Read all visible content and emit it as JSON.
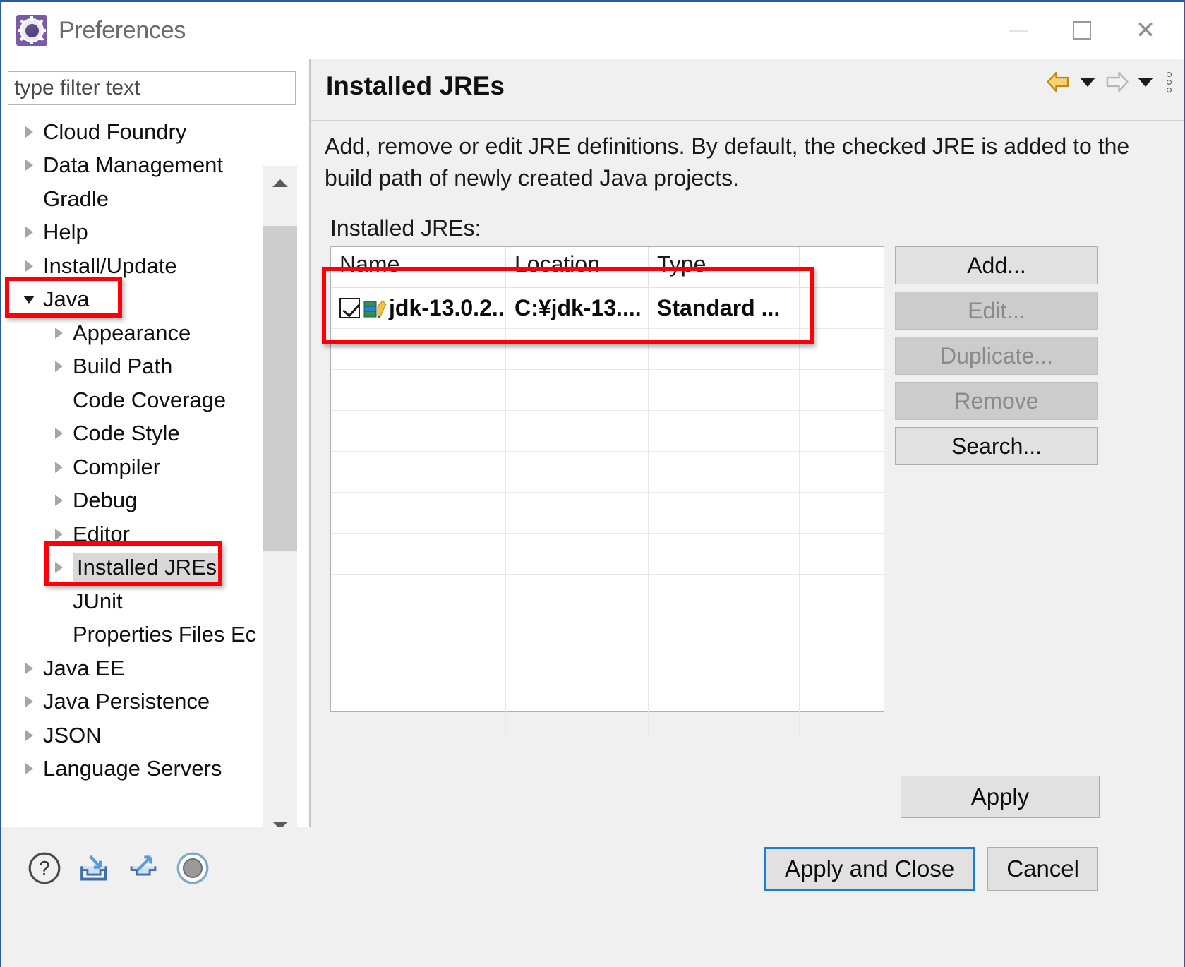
{
  "window": {
    "title": "Preferences",
    "icon": "preferences-gear-icon",
    "controls": {
      "minimize": "—",
      "maximize": "□",
      "close": "✕"
    }
  },
  "sidebar": {
    "filter": {
      "placeholder": "type filter text",
      "value": ""
    },
    "items": [
      {
        "label": "Cloud Foundry",
        "depth": 0,
        "twisty": "right",
        "selected": false
      },
      {
        "label": "Data Management",
        "depth": 0,
        "twisty": "right",
        "selected": false
      },
      {
        "label": "Gradle",
        "depth": 0,
        "twisty": "none",
        "selected": false
      },
      {
        "label": "Help",
        "depth": 0,
        "twisty": "right",
        "selected": false
      },
      {
        "label": "Install/Update",
        "depth": 0,
        "twisty": "right",
        "selected": false
      },
      {
        "label": "Java",
        "depth": 0,
        "twisty": "down",
        "selected": false
      },
      {
        "label": "Appearance",
        "depth": 1,
        "twisty": "right",
        "selected": false
      },
      {
        "label": "Build Path",
        "depth": 1,
        "twisty": "right",
        "selected": false
      },
      {
        "label": "Code Coverage",
        "depth": 1,
        "twisty": "none",
        "selected": false
      },
      {
        "label": "Code Style",
        "depth": 1,
        "twisty": "right",
        "selected": false
      },
      {
        "label": "Compiler",
        "depth": 1,
        "twisty": "right",
        "selected": false
      },
      {
        "label": "Debug",
        "depth": 1,
        "twisty": "right",
        "selected": false
      },
      {
        "label": "Editor",
        "depth": 1,
        "twisty": "right",
        "selected": false
      },
      {
        "label": "Installed JREs",
        "depth": 1,
        "twisty": "right",
        "selected": true
      },
      {
        "label": "JUnit",
        "depth": 1,
        "twisty": "none",
        "selected": false
      },
      {
        "label": "Properties Files Ec",
        "depth": 1,
        "twisty": "none",
        "selected": false
      },
      {
        "label": "Java EE",
        "depth": 0,
        "twisty": "right",
        "selected": false
      },
      {
        "label": "Java Persistence",
        "depth": 0,
        "twisty": "right",
        "selected": false
      },
      {
        "label": "JSON",
        "depth": 0,
        "twisty": "right",
        "selected": false
      },
      {
        "label": "Language Servers",
        "depth": 0,
        "twisty": "right",
        "selected": false
      }
    ]
  },
  "page": {
    "title": "Installed JREs",
    "description": "Add, remove or edit JRE definitions. By default, the checked JRE is added to the build path of newly created Java projects.",
    "list_label": "Installed JREs:",
    "nav": {
      "back_icon": "back-arrow-icon",
      "back_dropdown_icon": "chevron-down-icon",
      "forward_icon": "forward-arrow-icon",
      "forward_dropdown_icon": "chevron-down-icon",
      "menu_icon": "view-menu-icon"
    }
  },
  "table": {
    "columns": [
      "Name",
      "Location",
      "Type",
      ""
    ],
    "rows": [
      {
        "checked": true,
        "icon": "jre-library-icon",
        "name": "jdk-13.0.2...",
        "location": "C:¥jdk-13....",
        "type": "Standard ..."
      }
    ],
    "empty_row_count": 10
  },
  "buttons": {
    "side": [
      {
        "label": "Add...",
        "enabled": true
      },
      {
        "label": "Edit...",
        "enabled": false
      },
      {
        "label": "Duplicate...",
        "enabled": false
      },
      {
        "label": "Remove",
        "enabled": false
      },
      {
        "label": "Search...",
        "enabled": true
      }
    ],
    "apply": "Apply"
  },
  "footer": {
    "icons": [
      {
        "name": "help-icon",
        "glyph": "?"
      },
      {
        "name": "import-icon",
        "glyph": "↘"
      },
      {
        "name": "export-icon",
        "glyph": "↗"
      },
      {
        "name": "restore-defaults-icon",
        "glyph": "●"
      }
    ],
    "apply_and_close": "Apply and Close",
    "cancel": "Cancel"
  },
  "annotations": [
    {
      "name": "annotation-java",
      "color": "#fb0008"
    },
    {
      "name": "annotation-installed-jres",
      "color": "#fb0008"
    },
    {
      "name": "annotation-jre-row",
      "color": "#fb0008"
    }
  ],
  "colors": {
    "accent_blue": "#1b7fd4",
    "annotation_red": "#fb0008",
    "panel_bg": "#f0f0f0",
    "title_purple": "#7a5ba8"
  }
}
